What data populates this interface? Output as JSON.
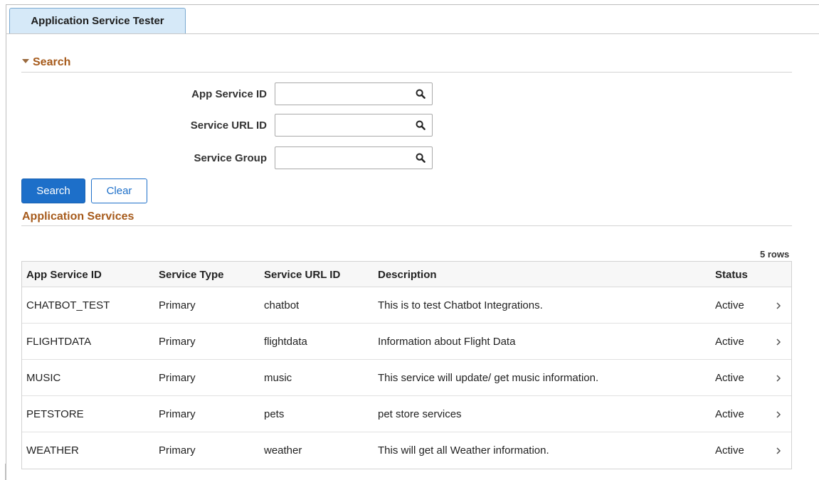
{
  "tab": {
    "label": "Application Service Tester"
  },
  "search_section": {
    "title": "Search",
    "fields": [
      {
        "label": "App Service ID",
        "value": "",
        "placeholder": ""
      },
      {
        "label": "Service URL ID",
        "value": "",
        "placeholder": ""
      },
      {
        "label": "Service Group",
        "value": "",
        "placeholder": ""
      }
    ],
    "search_button": "Search",
    "clear_button": "Clear"
  },
  "results_section": {
    "title": "Application Services",
    "row_count": "5 rows",
    "columns": [
      "App Service ID",
      "Service Type",
      "Service URL ID",
      "Description",
      "Status"
    ],
    "rows": [
      {
        "app_service_id": "CHATBOT_TEST",
        "service_type": "Primary",
        "service_url_id": "chatbot",
        "description": "This is to test Chatbot Integrations.",
        "status": "Active"
      },
      {
        "app_service_id": "FLIGHTDATA",
        "service_type": "Primary",
        "service_url_id": "flightdata",
        "description": "Information about Flight Data",
        "status": "Active"
      },
      {
        "app_service_id": "MUSIC",
        "service_type": "Primary",
        "service_url_id": "music",
        "description": "This service will update/ get music information.",
        "status": "Active"
      },
      {
        "app_service_id": "PETSTORE",
        "service_type": "Primary",
        "service_url_id": "pets",
        "description": "pet store services",
        "status": "Active"
      },
      {
        "app_service_id": "WEATHER",
        "service_type": "Primary",
        "service_url_id": "weather",
        "description": "This will get all Weather information.",
        "status": "Active"
      }
    ]
  },
  "icons": {
    "field_lookup": "search-icon",
    "section_toggle": "caret-down-icon",
    "row_action": "chevron-right-icon"
  },
  "colors": {
    "accent": "#1d6fc9",
    "section_title": "#a65a1b",
    "tab_background": "#d6e9f8"
  }
}
